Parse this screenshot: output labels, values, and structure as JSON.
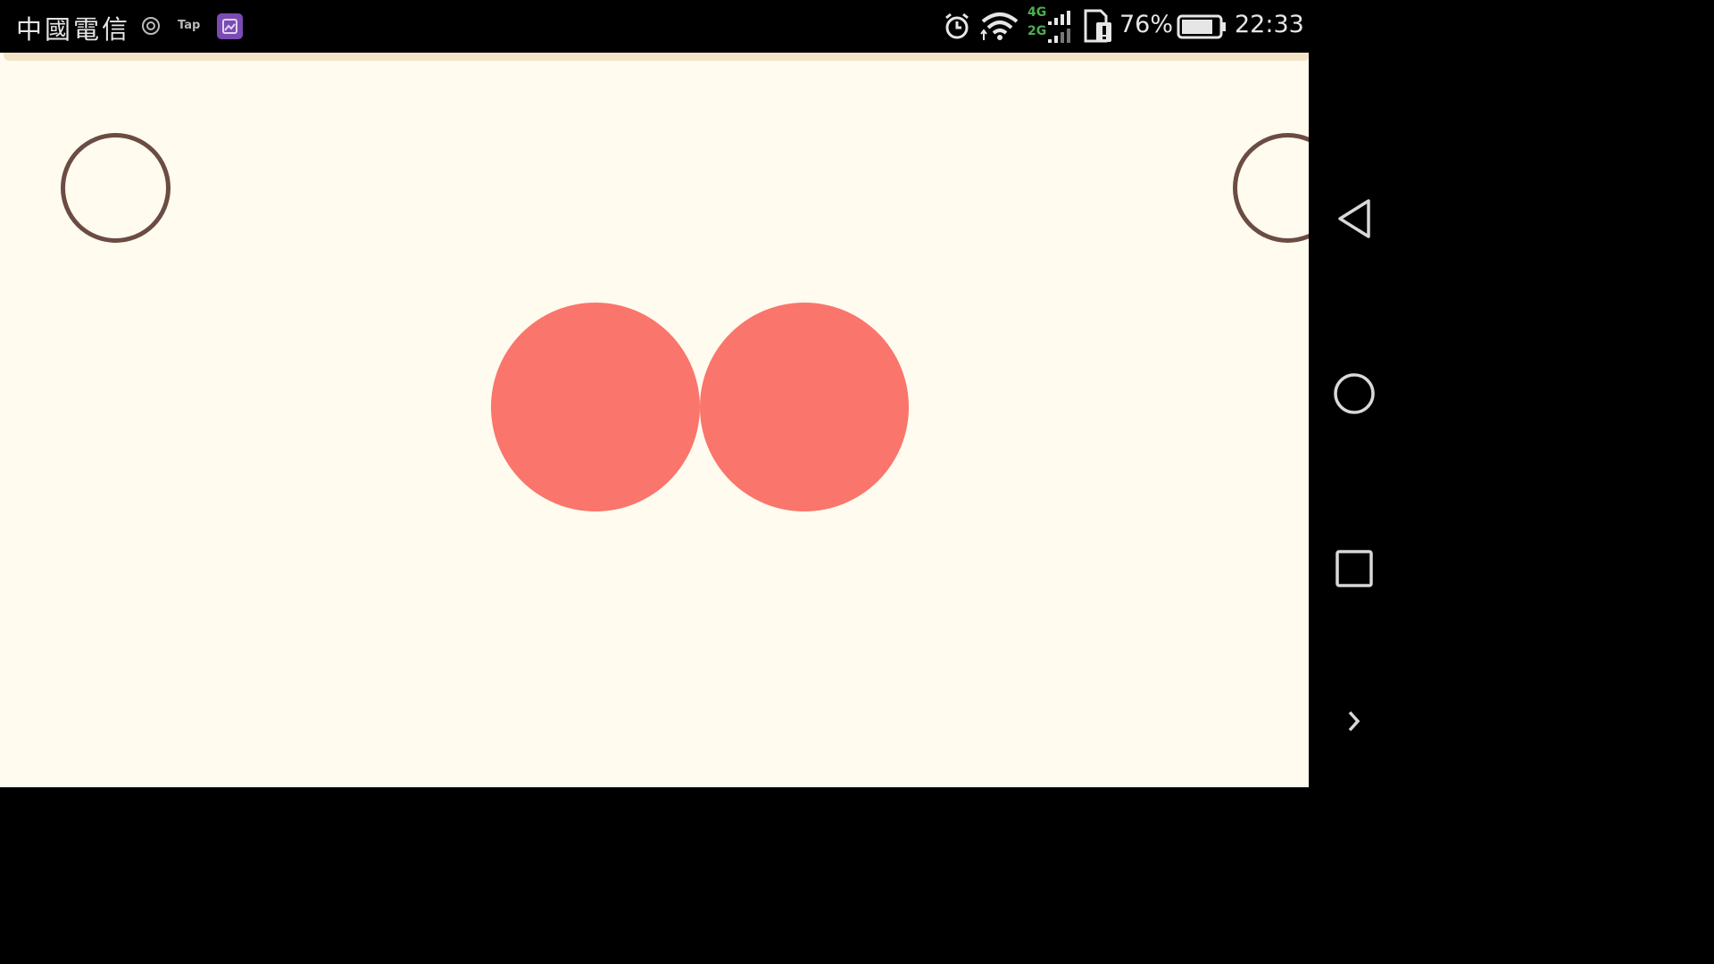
{
  "status_bar": {
    "carrier": "中國電信",
    "network_top": "4G",
    "network_bottom": "2G",
    "battery_percent": "76%",
    "time": "22:33",
    "icons": [
      "notification-icon",
      "tap-app-icon",
      "gallery-app-icon",
      "alarm-icon",
      "wifi-icon",
      "signal-icon",
      "sim-icon",
      "battery-icon"
    ]
  },
  "app": {
    "background_color": "#fffbef",
    "ring_color": "#6b4c43",
    "blob_color": "#fa756c",
    "strip_color": "#f3e4c8"
  },
  "nav_bar": {
    "buttons": [
      "back-icon",
      "home-icon",
      "recents-icon",
      "expand-chevron-icon"
    ]
  },
  "tap_icon_label": "Tap"
}
